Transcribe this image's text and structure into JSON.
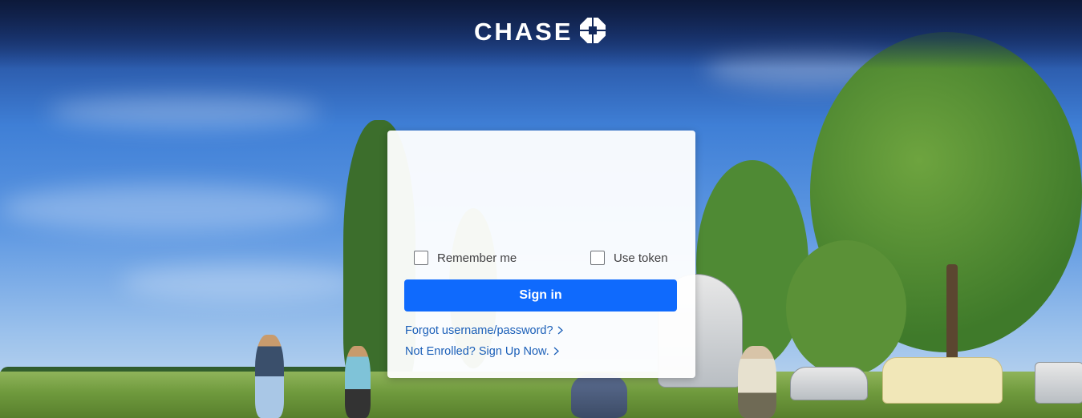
{
  "brand": {
    "name": "CHASE",
    "logo_icon": "chase-octagon-icon",
    "logo_color": "#ffffff",
    "header_color": "#12285c"
  },
  "login_card": {
    "remember_me_label": "Remember me",
    "use_token_label": "Use token",
    "remember_me_checked": false,
    "use_token_checked": false,
    "sign_in_label": "Sign in",
    "sign_in_color": "#0f6afd",
    "forgot_link": "Forgot username/password?",
    "enroll_link": "Not Enrolled? Sign Up Now.",
    "link_icon": "chevron-right-icon",
    "link_color": "#1b5fb8"
  }
}
